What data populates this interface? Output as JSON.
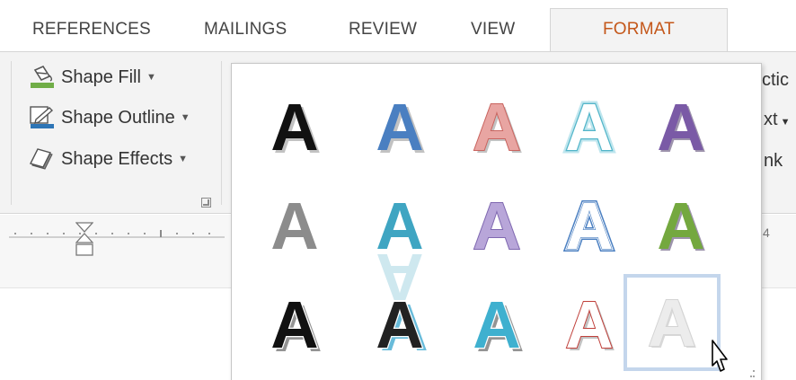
{
  "tabs": [
    {
      "label": "REFERENCES"
    },
    {
      "label": "MAILINGS"
    },
    {
      "label": "REVIEW"
    },
    {
      "label": "VIEW"
    },
    {
      "label": "FORMAT",
      "active": true
    }
  ],
  "shape_styles": {
    "fill": {
      "label": "Shape Fill",
      "icon": "paint-bucket-icon",
      "color": "#70ad47"
    },
    "outline": {
      "label": "Shape Outline",
      "icon": "pencil-outline-icon",
      "color": "#2e75b6"
    },
    "effects": {
      "label": "Shape Effects",
      "icon": "shape-effects-icon"
    }
  },
  "right_partial_labels": {
    "row1": "ctic",
    "row2": "xt",
    "row3": "nk"
  },
  "ruler": {
    "partial_number": "4"
  },
  "gallery": {
    "letter": "A",
    "selected_index": 14,
    "styles": [
      {
        "fill": "#111111",
        "stroke": "none",
        "effect": "shadow"
      },
      {
        "fill": "#4a7fc1",
        "stroke": "none",
        "effect": "shadow"
      },
      {
        "fill": "#e8a5a2",
        "stroke": "#c9645f",
        "effect": "shadow"
      },
      {
        "fill": "#ffffff",
        "stroke": "#52b5c9",
        "effect": "glow"
      },
      {
        "fill": "#7a5aa6",
        "stroke": "none",
        "effect": "bevel"
      },
      {
        "fill": "#8c8c8c",
        "stroke": "none",
        "effect": "flat"
      },
      {
        "fill": "#3fa5c2",
        "stroke": "none",
        "effect": "reflection"
      },
      {
        "fill": "#b8a6d9",
        "stroke": "#7f68b0",
        "effect": "flat"
      },
      {
        "fill": "#ffffff",
        "stroke": "#4a7fc1",
        "effect": "double-outline"
      },
      {
        "fill": "#74a83f",
        "stroke": "none",
        "effect": "bevel"
      },
      {
        "fill": "#111111",
        "stroke": "#ffffff",
        "effect": "hard-shadow"
      },
      {
        "fill": "#222222",
        "stroke": "#ffffff",
        "effect": "blue-shadow"
      },
      {
        "fill": "#3fb0cf",
        "stroke": "#ffffff",
        "effect": "hard-shadow"
      },
      {
        "fill": "#ffffff",
        "stroke": "#c0403b",
        "effect": "shadow"
      },
      {
        "fill": "#ececec",
        "stroke": "#d4d4d4",
        "effect": "emboss"
      }
    ]
  }
}
